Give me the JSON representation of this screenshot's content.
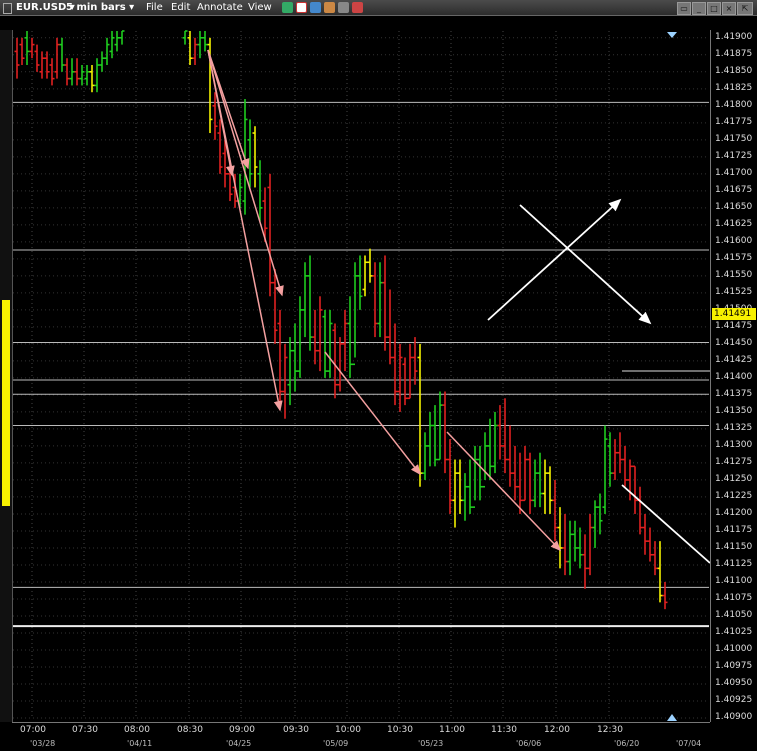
{
  "toolbar": {
    "symbol": "EUR.USD",
    "interval": "5 min bars",
    "menus": [
      "File",
      "Edit",
      "Annotate",
      "View"
    ]
  },
  "chart_data": {
    "type": "bar",
    "title": "",
    "ylim": [
      1.409,
      1.4191
    ],
    "y_ticks": [
      "1.41900",
      "1.41875",
      "1.41850",
      "1.41825",
      "1.41800",
      "1.41775",
      "1.41750",
      "1.41725",
      "1.41700",
      "1.41675",
      "1.41650",
      "1.41625",
      "1.41600",
      "1.41575",
      "1.41550",
      "1.41525",
      "1.41500",
      "1.41475",
      "1.41450",
      "1.41425",
      "1.41400",
      "1.41375",
      "1.41350",
      "1.41325",
      "1.41300",
      "1.41275",
      "1.41250",
      "1.41225",
      "1.41200",
      "1.41175",
      "1.41150",
      "1.41125",
      "1.41100",
      "1.41075",
      "1.41050",
      "1.41025",
      "1.41000",
      "1.40975",
      "1.40950",
      "1.40925",
      "1.40900"
    ],
    "x_ticks": [
      "07:00",
      "07:30",
      "08:00",
      "08:30",
      "09:00",
      "09:30",
      "10:00",
      "10:30",
      "11:00",
      "11:30",
      "12:00",
      "12:30"
    ],
    "date_ticks": [
      "'03/28",
      "'04/11",
      "'04/25",
      "'05/09",
      "'05/23",
      "'06/06",
      "'06/20",
      "'07/04"
    ],
    "current_price": "1.41491",
    "horizontal_levels": [
      1.41805,
      1.41588,
      1.41452,
      1.41397,
      1.41376,
      1.4133,
      1.41092,
      1.41035
    ],
    "bar_colors": {
      "up": "#1fcc1f",
      "down": "#e02020",
      "neutral": "#f2f000"
    }
  }
}
